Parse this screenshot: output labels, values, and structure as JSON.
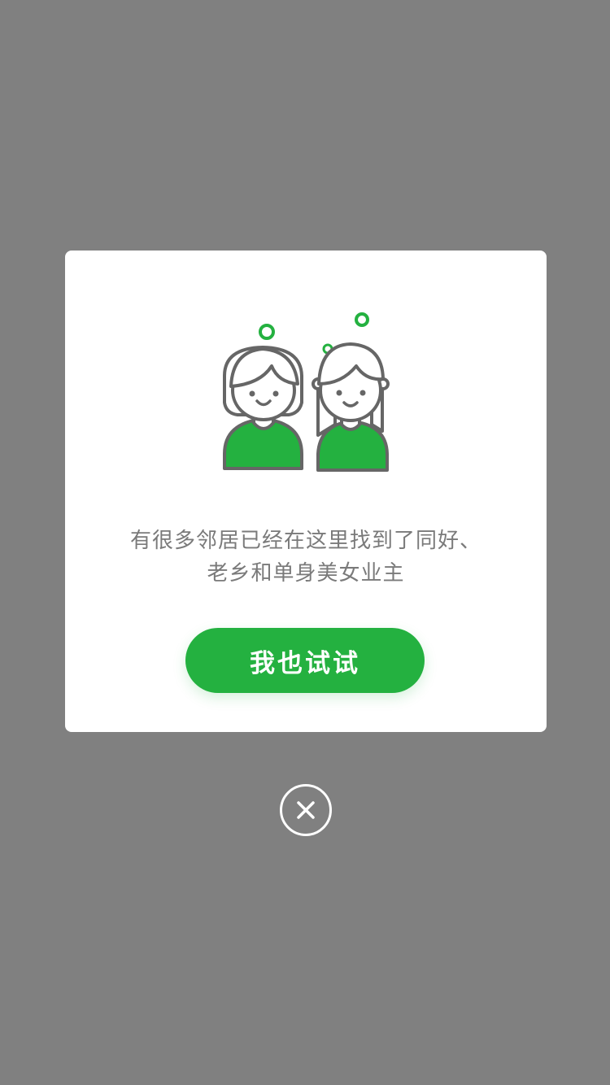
{
  "dialog": {
    "illustration_icon": "two-neighbors-illustration",
    "message_lines": [
      "有很多邻居已经在这里找到了同好、",
      "老乡和单身美女业主"
    ],
    "cta_label": "我也试试"
  },
  "close": {
    "icon": "close-icon"
  },
  "colors": {
    "overlay": "#808080",
    "dialog_background": "#ffffff",
    "accent": "#24b140",
    "message_text": "#7a7a7a",
    "illustration_stroke": "#666666"
  }
}
